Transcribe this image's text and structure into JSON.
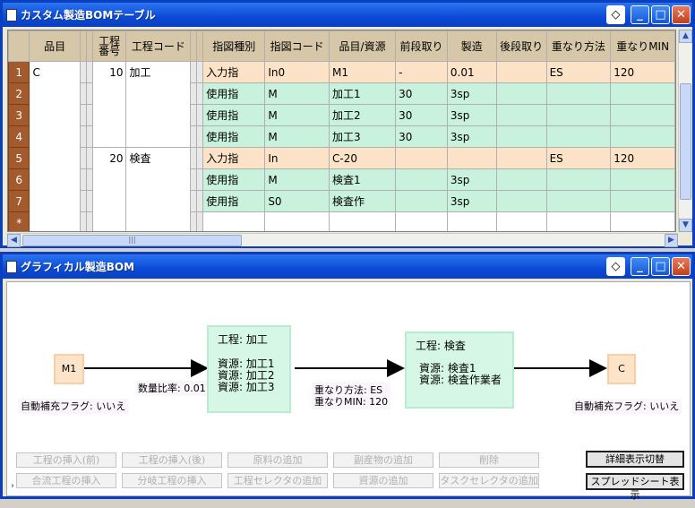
{
  "win_table": {
    "title": "カスタム製造BOMテーブル"
  },
  "win_graph": {
    "title": "グラフィカル製造BOM"
  },
  "columns": [
    "品目",
    "工程\n番号",
    "工程コード",
    "指図種別",
    "指図コード",
    "品目/資源",
    "前段取り",
    "製造",
    "後段取り",
    "重なり方法",
    "重なりMIN"
  ],
  "rows": [
    {
      "n": "1",
      "item": "C",
      "proc_no": "10",
      "proc_code": "加工",
      "type": "入力指",
      "code": "In0",
      "res": "M1",
      "pre": "-",
      "mfg": "0.01",
      "post": "",
      "ov": "ES",
      "ovmin": "120",
      "style": "orange"
    },
    {
      "n": "2",
      "item": "",
      "proc_no": "",
      "proc_code": "",
      "type": "使用指",
      "code": "M",
      "res": "加工1",
      "pre": "30",
      "mfg": "3sp",
      "post": "",
      "ov": "",
      "ovmin": "",
      "style": "green"
    },
    {
      "n": "3",
      "item": "",
      "proc_no": "",
      "proc_code": "",
      "type": "使用指",
      "code": "M",
      "res": "加工2",
      "pre": "30",
      "mfg": "3sp",
      "post": "",
      "ov": "",
      "ovmin": "",
      "style": "green"
    },
    {
      "n": "4",
      "item": "",
      "proc_no": "",
      "proc_code": "",
      "type": "使用指",
      "code": "M",
      "res": "加工3",
      "pre": "30",
      "mfg": "3sp",
      "post": "",
      "ov": "",
      "ovmin": "",
      "style": "green"
    },
    {
      "n": "5",
      "item": "",
      "proc_no": "20",
      "proc_code": "検査",
      "type": "入力指",
      "code": "In",
      "res": "C-20",
      "pre": "",
      "mfg": "",
      "post": "",
      "ov": "ES",
      "ovmin": "120",
      "style": "orange"
    },
    {
      "n": "6",
      "item": "",
      "proc_no": "",
      "proc_code": "",
      "type": "使用指",
      "code": "M",
      "res": "検査1",
      "pre": "",
      "mfg": "3sp",
      "post": "",
      "ov": "",
      "ovmin": "",
      "style": "green"
    },
    {
      "n": "7",
      "item": "",
      "proc_no": "",
      "proc_code": "",
      "type": "使用指",
      "code": "S0",
      "res": "検査作",
      "pre": "",
      "mfg": "3sp",
      "post": "",
      "ov": "",
      "ovmin": "",
      "style": "green"
    },
    {
      "n": "*",
      "item": "",
      "proc_no": "",
      "proc_code": "",
      "type": "",
      "code": "",
      "res": "",
      "pre": "",
      "mfg": "",
      "post": "",
      "ov": "",
      "ovmin": "",
      "style": "blank"
    }
  ],
  "graph": {
    "m1": "M1",
    "c": "C",
    "proc1_title": "工程: 加工",
    "proc1_res": [
      "資源: 加工1",
      "資源: 加工2",
      "資源: 加工3"
    ],
    "proc2_title": "工程: 検査",
    "proc2_res": [
      "資源: 検査1",
      "資源: 検査作業者"
    ],
    "auto_flag_left": "自動補充フラグ: いいえ",
    "auto_flag_right": "自動補充フラグ: いいえ",
    "ratio": "数量比率: 0.01",
    "overlap_method": "重なり方法: ES",
    "overlap_min": "重なりMIN: 120"
  },
  "buttons": {
    "insert_before": "工程の挿入(前)",
    "insert_after": "工程の挿入(後)",
    "add_material": "原料の追加",
    "add_byproduct": "副産物の追加",
    "delete": "削除",
    "insert_merge": "合流工程の挿入",
    "insert_branch": "分岐工程の挿入",
    "add_proc_selector": "工程セレクタの追加",
    "add_resource": "資源の追加",
    "add_task_selector": "タスクセレクタの追加",
    "toggle_detail": "詳細表示切替",
    "show_spreadsheet": "スプレッドシート表示"
  }
}
